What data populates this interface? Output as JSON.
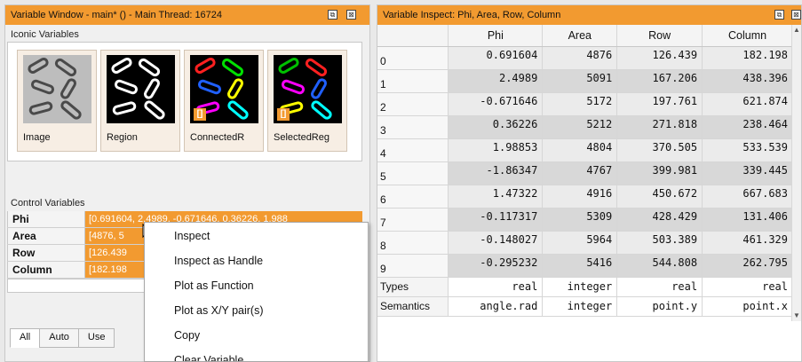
{
  "left_window": {
    "title": "Variable Window - main* () - Main Thread: 16724",
    "float_icon": "⧉",
    "close_icon": "⊠",
    "iconic_label": "Iconic Variables",
    "thumbnails": [
      {
        "caption": "Image",
        "kind": "image",
        "badge": ""
      },
      {
        "caption": "Region",
        "kind": "region",
        "badge": ""
      },
      {
        "caption": "ConnectedR",
        "kind": "connected",
        "badge": "[]"
      },
      {
        "caption": "SelectedReg",
        "kind": "selected",
        "badge": "[]"
      }
    ],
    "control_label": "Control Variables",
    "controls": [
      {
        "name": "Phi",
        "value": "[0.691604, 2.4989, -0.671646, 0.36226, 1.988"
      },
      {
        "name": "Area",
        "value": "[4876, 5"
      },
      {
        "name": "Row",
        "value": "[126.439"
      },
      {
        "name": "Column",
        "value": "[182.198"
      }
    ],
    "tabs": [
      "All",
      "Auto",
      "Use"
    ]
  },
  "context_menu": {
    "items": [
      "Inspect",
      "Inspect as Handle",
      "Plot as Function",
      "Plot as X/Y pair(s)",
      "Copy",
      "Clear Variable"
    ]
  },
  "right_window": {
    "title": "Variable Inspect: Phi, Area, Row, Column",
    "float_icon": "⧉",
    "close_icon": "⊠",
    "columns": [
      "Phi",
      "Area",
      "Row",
      "Column"
    ],
    "rows": [
      {
        "index": "0",
        "phi": "0.691604",
        "area": "4876",
        "row": "126.439",
        "column": "182.198"
      },
      {
        "index": "1",
        "phi": "2.4989",
        "area": "5091",
        "row": "167.206",
        "column": "438.396"
      },
      {
        "index": "2",
        "phi": "-0.671646",
        "area": "5172",
        "row": "197.761",
        "column": "621.874"
      },
      {
        "index": "3",
        "phi": "0.36226",
        "area": "5212",
        "row": "271.818",
        "column": "238.464"
      },
      {
        "index": "4",
        "phi": "1.98853",
        "area": "4804",
        "row": "370.505",
        "column": "533.539"
      },
      {
        "index": "5",
        "phi": "-1.86347",
        "area": "4767",
        "row": "399.981",
        "column": "339.445"
      },
      {
        "index": "6",
        "phi": "1.47322",
        "area": "4916",
        "row": "450.672",
        "column": "667.683"
      },
      {
        "index": "7",
        "phi": "-0.117317",
        "area": "5309",
        "row": "428.429",
        "column": "131.406"
      },
      {
        "index": "8",
        "phi": "-0.148027",
        "area": "5964",
        "row": "503.389",
        "column": "461.329"
      },
      {
        "index": "9",
        "phi": "-0.295232",
        "area": "5416",
        "row": "544.808",
        "column": "262.795"
      }
    ],
    "types_label": "Types",
    "types": [
      "real",
      "integer",
      "real",
      "real"
    ],
    "semantics_label": "Semantics",
    "semantics": [
      "angle.rad",
      "integer",
      "point.y",
      "point.x"
    ]
  },
  "colors": {
    "accent": "#f29a30",
    "row_light": "#ebebeb",
    "row_dark": "#d8d8d8"
  }
}
